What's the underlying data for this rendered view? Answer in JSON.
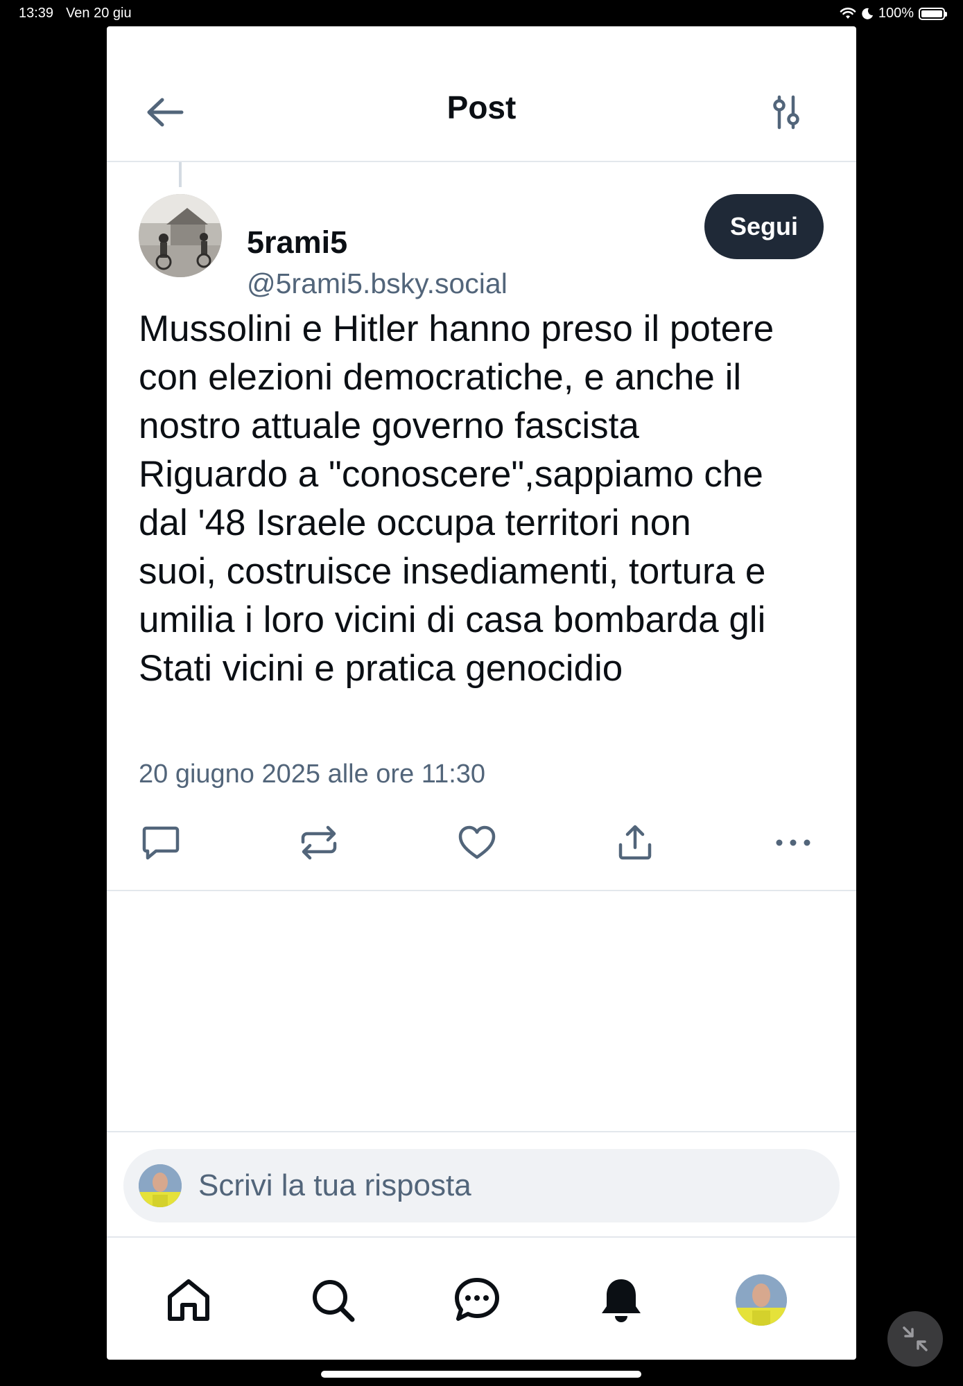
{
  "status_bar": {
    "time": "13:39",
    "date": "Ven 20 giu",
    "battery": "100%"
  },
  "header": {
    "title": "Post"
  },
  "post": {
    "display_name": "5rami5",
    "handle": "@5rami5.bsky.social",
    "follow_label": "Segui",
    "text": "Mussolini e Hitler hanno preso il potere\ncon elezioni democratiche, e anche il\nnostro attuale governo fascista\nRiguardo a \"conoscere\",sappiamo che\ndal '48 Israele occupa territori non\nsuoi, costruisce insediamenti, tortura e\numilia i loro vicini di casa bombarda gli\nStati vicini e pratica genocidio",
    "timestamp": "20 giugno 2025 alle ore 11:30"
  },
  "actions": [
    "reply-icon",
    "repost-icon",
    "like-icon",
    "share-icon",
    "more-icon"
  ],
  "reply": {
    "placeholder": "Scrivi la tua risposta"
  },
  "tabbar": [
    "home-icon",
    "search-icon",
    "messages-icon",
    "notifications-icon",
    "profile-avatar"
  ],
  "colors": {
    "accent_dark": "#1f2937",
    "muted_text": "#52657a",
    "icon": "#52657a",
    "divider": "#e3e7ec"
  }
}
